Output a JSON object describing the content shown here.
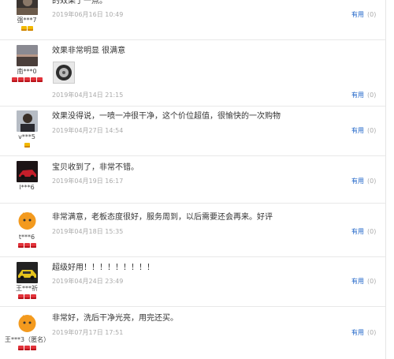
{
  "useful_label": "有用",
  "reviews": [
    {
      "user": "强***7",
      "content": "的效果了一点。",
      "date": "2019年06月16日 10:49",
      "useful_count": "(0)",
      "avatar_icon": "avatar-dark-icon",
      "badge_color": "gold",
      "badge_count": 2
    },
    {
      "user": "南***0",
      "content": "效果非常明显 很满意",
      "date": "2019年04月14日 21:15",
      "useful_count": "(0)",
      "avatar_icon": "avatar-landscape-icon",
      "badge_color": "red",
      "badge_count": 5,
      "has_photo": true,
      "photo_icon": "tire-photo-icon"
    },
    {
      "user": "v***5",
      "content": "效果没得说，一喷一冲很干净，这个价位超值，很愉快的一次购物",
      "date": "2019年04月27日 14:54",
      "useful_count": "(0)",
      "avatar_icon": "avatar-person-icon",
      "badge_color": "gold",
      "badge_count": 1
    },
    {
      "user": "l***6",
      "content": "宝贝收到了，非常不错。",
      "date": "2019年04月19日 16:17",
      "useful_count": "(0)",
      "avatar_icon": "avatar-car-icon",
      "badge_color": "red",
      "badge_count": 0
    },
    {
      "user": "t***6",
      "content": "非常满意，老板态度很好，服务周到，以后需要还会再来。好评",
      "date": "2019年04月18日 15:35",
      "useful_count": "(0)",
      "avatar_icon": "avatar-default-icon",
      "badge_color": "red",
      "badge_count": 3
    },
    {
      "user": "王***祈",
      "content": "超级好用！！！！！！！！！",
      "date": "2019年04月24日 23:49",
      "useful_count": "(0)",
      "avatar_icon": "avatar-yellow-car-icon",
      "badge_color": "red",
      "badge_count": 3
    },
    {
      "user": "王***3（匿名）",
      "content": "非常好，洗后干净光亮，用完还买。",
      "date": "2019年07月17日 17:51",
      "useful_count": "(0)",
      "avatar_icon": "avatar-default-icon",
      "badge_color": "red",
      "badge_count": 3
    }
  ]
}
